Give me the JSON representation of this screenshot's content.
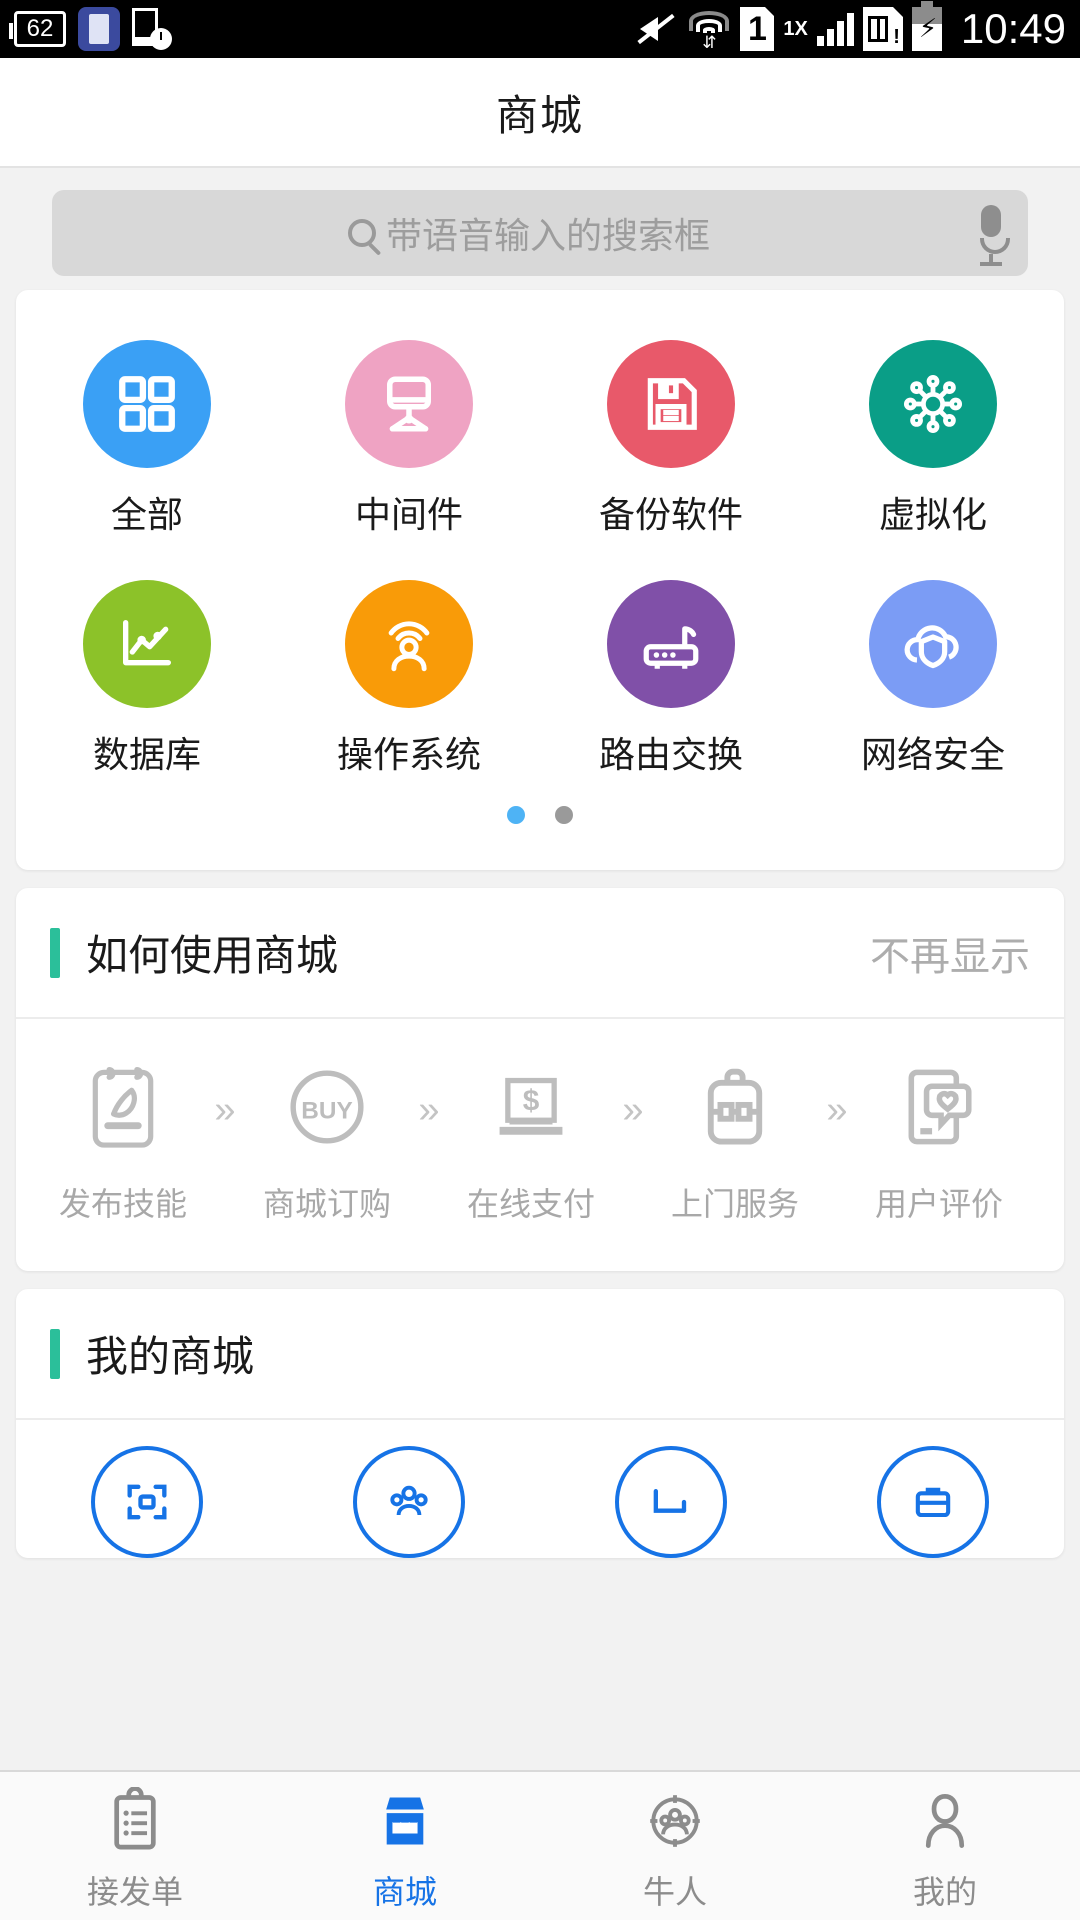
{
  "statusbar": {
    "battery_badge": "62",
    "network_label": "1X",
    "sim_label": "1",
    "clock": "10:49",
    "icons": [
      "battery-saver-icon",
      "phone-charging-icon",
      "phone-timer-icon",
      "vibrate-mute-icon",
      "wifi-icon",
      "sim-slot-icon",
      "signal-bars-icon",
      "sim-alert-icon",
      "battery-charging-icon"
    ]
  },
  "header": {
    "title": "商城"
  },
  "search": {
    "placeholder": "带语音输入的搜索框",
    "value": "",
    "mic_icon": "microphone-icon",
    "search_icon": "search-icon"
  },
  "categories": {
    "items": [
      {
        "label": "全部",
        "color": "#3aa0f5",
        "icon": "grid-squares-icon"
      },
      {
        "label": "中间件",
        "color": "#efa3c3",
        "icon": "desktop-monitor-icon"
      },
      {
        "label": "备份软件",
        "color": "#e8596a",
        "icon": "floppy-disk-icon"
      },
      {
        "label": "虚拟化",
        "color": "#0a9e87",
        "icon": "virus-node-icon"
      },
      {
        "label": "数据库",
        "color": "#8cc229",
        "icon": "line-chart-icon"
      },
      {
        "label": "操作系统",
        "color": "#f99b08",
        "icon": "broadcast-users-icon"
      },
      {
        "label": "路由交换",
        "color": "#8050a8",
        "icon": "router-icon"
      },
      {
        "label": "网络安全",
        "color": "#7b9cf5",
        "icon": "cloud-shield-icon"
      }
    ],
    "pager": {
      "count": 2,
      "active_index": 0,
      "active_color": "#4eb3f5",
      "inactive_color": "#9a9a9a"
    }
  },
  "howto": {
    "title": "如何使用商城",
    "dismiss_label": "不再显示",
    "accent_color": "#2bbf9a",
    "separator": "»",
    "steps": [
      {
        "label": "发布技能",
        "icon": "clipboard-pen-icon"
      },
      {
        "label": "商城订购",
        "icon": "buy-circle-icon"
      },
      {
        "label": "在线支付",
        "icon": "laptop-dollar-icon"
      },
      {
        "label": "上门服务",
        "icon": "toolbox-icon"
      },
      {
        "label": "用户评价",
        "icon": "phone-heart-icon"
      }
    ]
  },
  "mymall": {
    "title": "我的商城",
    "accent_color": "#2bbf9a",
    "items": [
      {
        "icon": "scan-frame-icon"
      },
      {
        "icon": "people-group-icon"
      },
      {
        "icon": "bracket-icon"
      },
      {
        "icon": "briefcase-icon"
      }
    ]
  },
  "tabbar": {
    "active_index": 1,
    "active_color": "#1673e6",
    "items": [
      {
        "label": "接发单",
        "icon": "clipboard-list-icon"
      },
      {
        "label": "商城",
        "icon": "shop-icon"
      },
      {
        "label": "牛人",
        "icon": "talent-group-icon"
      },
      {
        "label": "我的",
        "icon": "person-icon"
      }
    ]
  }
}
